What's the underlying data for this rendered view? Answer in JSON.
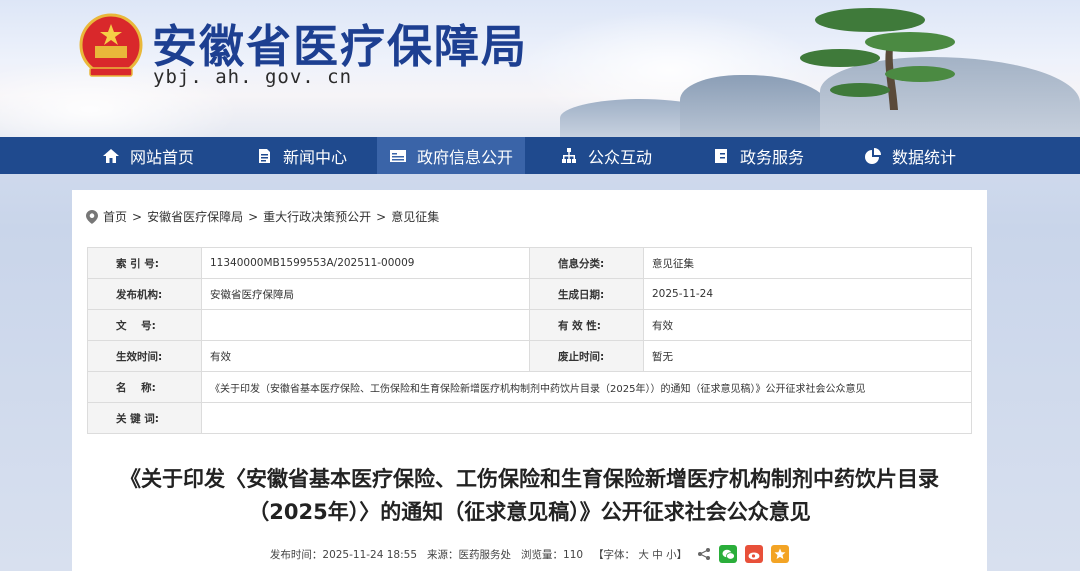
{
  "site": {
    "title": "安徽省医疗保障局",
    "domain": "ybj. ah. gov. cn"
  },
  "nav": [
    {
      "label": "网站首页",
      "icon": "home-icon"
    },
    {
      "label": "新闻中心",
      "icon": "document-icon"
    },
    {
      "label": "政府信息公开",
      "icon": "id-card-icon"
    },
    {
      "label": "公众互动",
      "icon": "org-chart-icon"
    },
    {
      "label": "政务服务",
      "icon": "book-icon"
    },
    {
      "label": "数据统计",
      "icon": "pie-chart-icon"
    }
  ],
  "breadcrumb": [
    "首页",
    "安徽省医疗保障局",
    "重大行政决策预公开",
    "意见征集"
  ],
  "breadcrumb_sep": ">",
  "meta": {
    "index_label": "索 引 号:",
    "index_value": "11340000MB1599553A/202511-00009",
    "category_label": "信息分类:",
    "category_value": "意见征集",
    "publisher_label": "发布机构:",
    "publisher_value": "安徽省医疗保障局",
    "date_label": "生成日期:",
    "date_value": "2025-11-24",
    "docno_label": "文    号:",
    "docno_value": "",
    "validity_label": "有 效 性:",
    "validity_value": "有效",
    "effective_label": "生效时间:",
    "effective_value": "有效",
    "abolish_label": "废止时间:",
    "abolish_value": "暂无",
    "name_label": "名    称:",
    "name_value": "《关于印发（安徽省基本医疗保险、工伤保险和生育保险新增医疗机构制剂中药饮片目录（2025年））的通知（征求意见稿）》公开征求社会公众意见",
    "keywords_label": "关 键 词:",
    "keywords_value": ""
  },
  "article": {
    "title": "《关于印发〈安徽省基本医疗保险、工伤保险和生育保险新增医疗机构制剂中药饮片目录（2025年）〉的通知（征求意见稿）》公开征求社会公众意见",
    "publish_label": "发布时间：",
    "publish_time": "2025-11-24 18:55",
    "source_label": "来源：",
    "source": "医药服务处",
    "views_label": "浏览量：",
    "views": "110",
    "font_label": "【字体：",
    "font_large": "大",
    "font_medium": "中",
    "font_small": "小",
    "font_close": "】"
  },
  "colors": {
    "nav_bg": "#1f4a8e",
    "nav_active": "#3a64a8",
    "title_blue": "#1d3f91",
    "wechat": "#2aae3a",
    "weibo": "#e8503a",
    "favorite": "#f3a425"
  }
}
